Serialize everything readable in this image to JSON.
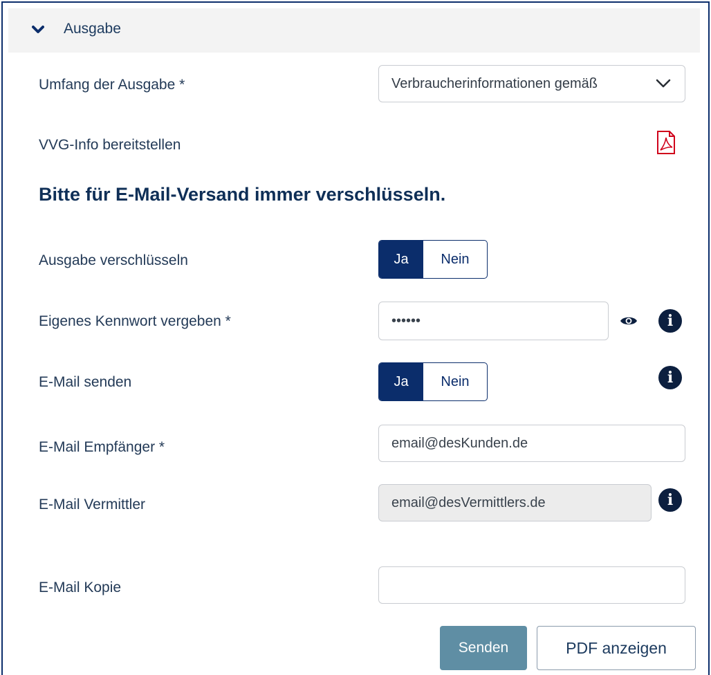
{
  "section": {
    "title": "Ausgabe"
  },
  "fields": {
    "scope_label": "Umfang der Ausgabe *",
    "scope_value": "Verbraucherinformationen gemäß",
    "vvg_label": "VVG-Info bereitstellen",
    "encrypt_heading": "Bitte für E-Mail-Versand immer verschlüsseln.",
    "encrypt_label": "Ausgabe verschlüsseln",
    "encrypt_yes": "Ja",
    "encrypt_no": "Nein",
    "password_label": "Eigenes Kennwort vergeben *",
    "password_value": "••••••",
    "email_send_label": "E-Mail senden",
    "email_send_yes": "Ja",
    "email_send_no": "Nein",
    "recipient_label": "E-Mail Empfänger *",
    "recipient_placeholder": "email@desKunden.de",
    "broker_label": "E-Mail Vermittler",
    "broker_value": "email@desVermittlers.de",
    "copy_label": "E-Mail Kopie",
    "copy_value": ""
  },
  "buttons": {
    "send": "Senden",
    "show_pdf": "PDF anzeigen"
  },
  "info_glyph": "i",
  "colors": {
    "brand_navy": "#0b2d6b",
    "send_button": "#5f8ea4",
    "pdf_red": "#d0021b",
    "header_bg": "#f3f3f3"
  },
  "icons": [
    "chevron-down-icon",
    "select-caret-icon",
    "pdf-icon",
    "eye-icon",
    "info-icon"
  ]
}
